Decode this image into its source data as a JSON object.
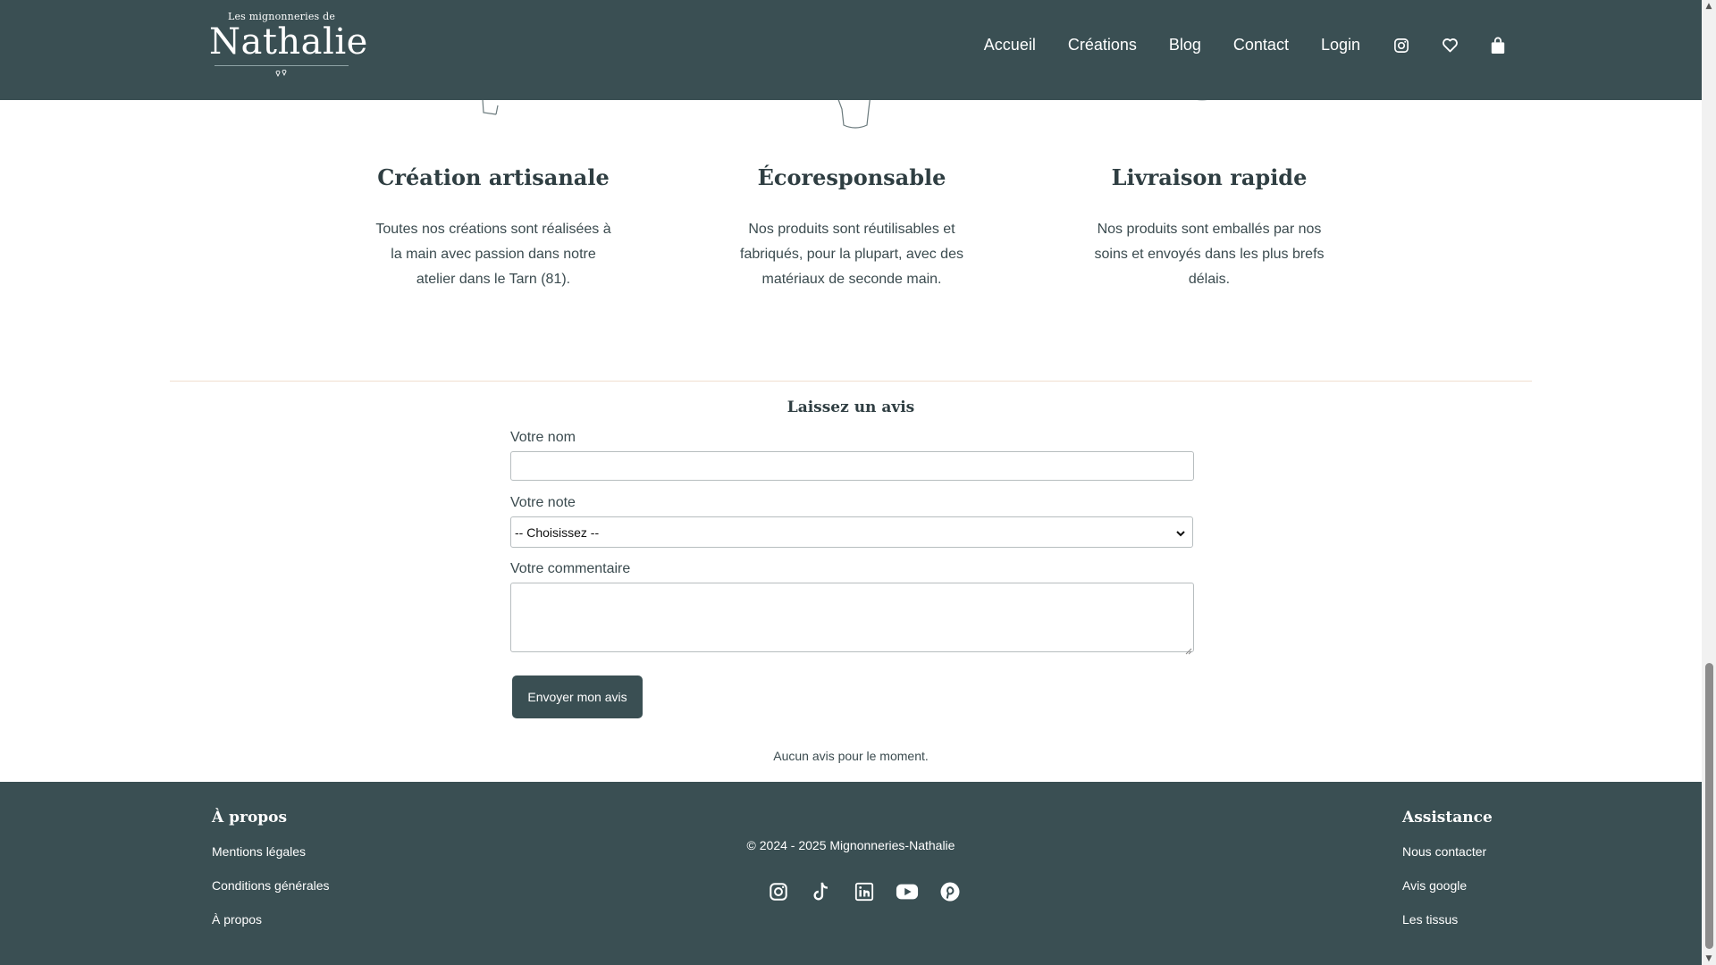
{
  "header": {
    "logo": {
      "top": "Les mignonneries de",
      "main": "Nathalie",
      "mark": "♡♡"
    },
    "nav": [
      {
        "label": "Accueil"
      },
      {
        "label": "Créations"
      },
      {
        "label": "Blog"
      },
      {
        "label": "Contact"
      },
      {
        "label": "Login"
      }
    ],
    "icons": [
      "instagram-icon",
      "heart-icon",
      "shopping-bag-icon"
    ]
  },
  "features": [
    {
      "title": "Création artisanale",
      "text": "Toutes nos créations sont réalisées à la main avec passion dans notre atelier dans le Tarn (81)."
    },
    {
      "title": "Écoresponsable",
      "text": "Nos produits sont réutilisables et fabriqués, pour la plupart, avec des matériaux de seconde main."
    },
    {
      "title": "Livraison rapide",
      "text": "Nos produits sont emballés par nos soins et envoyés dans les plus brefs délais."
    }
  ],
  "review": {
    "title": "Laissez un avis",
    "name_label": "Votre nom",
    "name_value": "",
    "rating_label": "Votre note",
    "rating_selected": "-- Choisissez --",
    "comment_label": "Votre commentaire",
    "comment_value": "",
    "submit_label": "Envoyer mon avis",
    "empty_text": "Aucun avis pour le moment."
  },
  "footer": {
    "about": {
      "heading": "À propos",
      "links": [
        "Mentions légales",
        "Conditions générales",
        "À propos"
      ]
    },
    "copyright": "© 2024 - 2025 Mignonneries-Nathalie",
    "socials": [
      "instagram-icon",
      "tiktok-icon",
      "linkedin-icon",
      "youtube-icon",
      "pinterest-icon"
    ],
    "assistance": {
      "heading": "Assistance",
      "links": [
        "Nous contacter",
        "Avis google",
        "Les tissus"
      ]
    }
  },
  "colors": {
    "primary": "#3a4f53",
    "text": "#2f3e42",
    "divider": "#f0dfcf"
  }
}
